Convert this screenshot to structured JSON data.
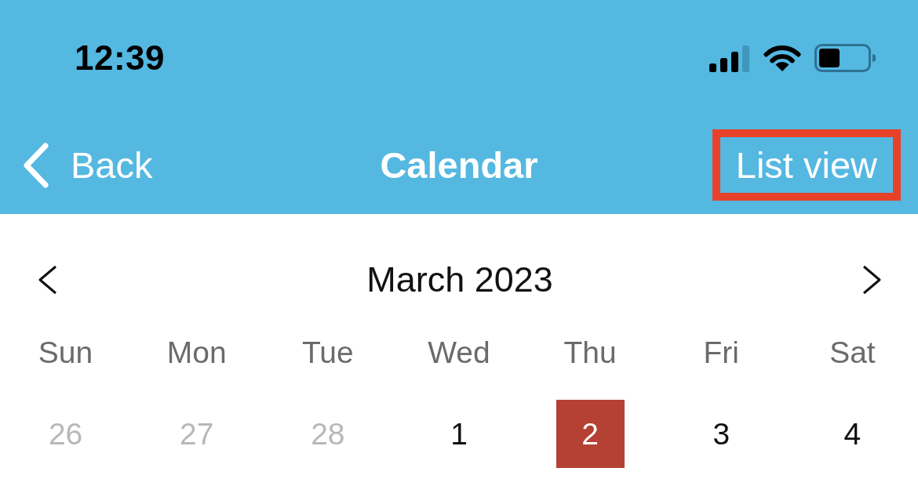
{
  "status_bar": {
    "time": "12:39"
  },
  "nav_bar": {
    "back_label": "Back",
    "title": "Calendar",
    "action": {
      "label": "List view",
      "highlighted": true
    }
  },
  "calendar": {
    "month": "March 2023",
    "weekdays": [
      "Sun",
      "Mon",
      "Tue",
      "Wed",
      "Thu",
      "Fri",
      "Sat"
    ],
    "days": [
      {
        "label": "26",
        "outside_month": true,
        "selected": false
      },
      {
        "label": "27",
        "outside_month": true,
        "selected": false
      },
      {
        "label": "28",
        "outside_month": true,
        "selected": false
      },
      {
        "label": "1",
        "outside_month": false,
        "selected": false
      },
      {
        "label": "2",
        "outside_month": false,
        "selected": true
      },
      {
        "label": "3",
        "outside_month": false,
        "selected": false
      },
      {
        "label": "4",
        "outside_month": false,
        "selected": false
      }
    ]
  }
}
